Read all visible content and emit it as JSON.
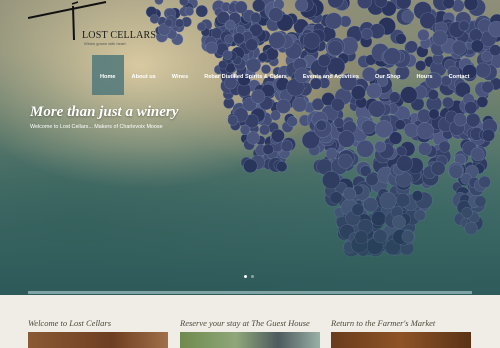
{
  "brand": {
    "name": "LOST CELLARS",
    "tagline": "Wines grown with heart"
  },
  "nav": {
    "items": [
      {
        "label": "Home",
        "active": true
      },
      {
        "label": "About us"
      },
      {
        "label": "Wines"
      },
      {
        "label": "Rebar Distilled Spirits & Ciders"
      },
      {
        "label": "Events and Activities"
      },
      {
        "label": "Our Shop"
      },
      {
        "label": "Hours"
      },
      {
        "label": "Contact"
      }
    ]
  },
  "hero": {
    "headline": "More than just a winery",
    "subline": "Welcome to Lost Cellars... Makers of Charlevoix Moose",
    "slides": 2,
    "active_slide": 1
  },
  "features": [
    {
      "title": "Welcome to Lost Cellars"
    },
    {
      "title": "Reserve your stay at The Guest House"
    },
    {
      "title": "Return to the Farmer's Market"
    }
  ],
  "colors": {
    "accent_bar": "#7fa3a2",
    "nav_active": "#50787a",
    "page_bg": "#f0ede6"
  }
}
